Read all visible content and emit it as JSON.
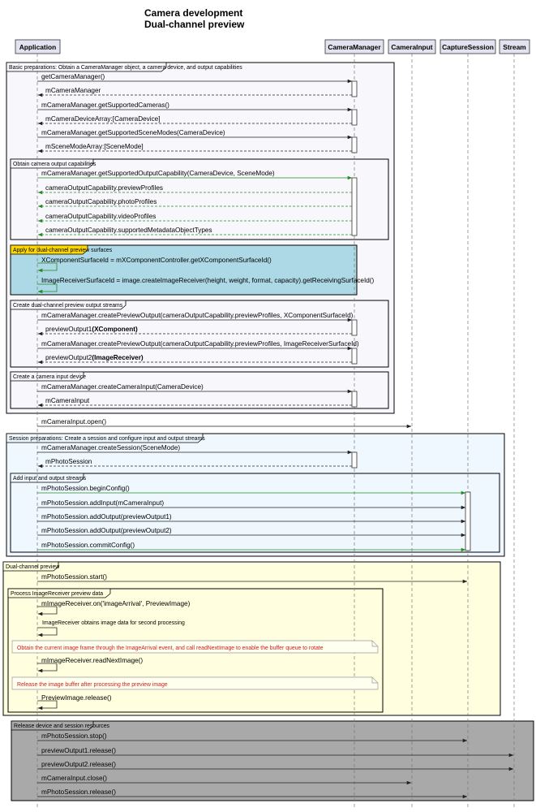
{
  "title": {
    "line1": "Camera development",
    "line2": "Dual-channel preview"
  },
  "participants": [
    "Application",
    "CameraManager",
    "CameraInput",
    "CaptureSession",
    "Stream"
  ],
  "groups": {
    "basic": "Basic preparations: Obtain a CameraManager object, a camera device, and output capabilities",
    "capabilities": "Obtain camera output capabilities",
    "apply_surfaces": "Apply for dual-channel preview surfaces",
    "create_streams": "Create dual-channel preview output streams",
    "create_input": "Create a camera input device",
    "session_prep": "Session preparations: Create a session and configure input and output streams",
    "add_streams": "Add input and output streams",
    "dual_preview": "Dual-channel preview",
    "process_receiver": "Process ImageReceiver preview data",
    "release": "Release device and session resources"
  },
  "messages": {
    "m1": "getCameraManager()",
    "m2": "mCameraManager",
    "m3": "mCameraManager.getSupportedCameras()",
    "m4": "mCameraDeviceArray:[CameraDevice]",
    "m5": "mCameraManager.getSupportedSceneModes(CameraDevice)",
    "m6": "mSceneModeArray:[SceneMode]",
    "m7": "mCameraManager.getSupportedOutputCapability(CameraDevice, SceneMode)",
    "m8": "cameraOutputCapability.previewProfiles",
    "m9": "cameraOutputCapability.photoProfiles",
    "m10": "cameraOutputCapability.videoProfiles",
    "m11": "cameraOutputCapability.supportedMetadataObjectTypes",
    "m12": "XComponentSurfaceId = mXComponentController.getXComponentSurfaceId()",
    "m13": "ImageReceiverSurfaceId = image.createImageReceiver(height, weight, format, capacity).getReceivingSurfaceId()",
    "m14": "mCameraManager.createPreviewOutput(cameraOutputCapability.previewProfiles, XComponentSurfaceId)",
    "m15a": "previewOutput1",
    "m15b": "(XComponent)",
    "m16": "mCameraManager.createPreviewOutput(cameraOutputCapability.previewProfiles, ImageReceiverSurfaceId)",
    "m17a": "previewOutput2",
    "m17b": "(ImageReceiver)",
    "m18": "mCameraManager.createCameraInput(CameraDevice)",
    "m19": "mCameraInput",
    "m20": "mCameraInput.open()",
    "m21": "mCameraManager.createSession(SceneMode)",
    "m22": "mPhotoSession",
    "m23": "mPhotoSession.beginConfig()",
    "m24": "mPhotoSession.addInput(mCameraInput)",
    "m25": "mPhotoSession.addOutput(previewOutput1)",
    "m26": "mPhotoSession.addOutput(previewOutput2)",
    "m27": "mPhotoSession.commitConfig()",
    "m28": "mPhotoSession.start()",
    "m29": "mImageReceiver.on('imageArrival', PreviewImage)",
    "m30": "ImageReceiver obtains image data for second processing",
    "m31": "mImageReceiver.readNextImage()",
    "m32": "PreviewImage.release()",
    "m33": "mPhotoSession.stop()",
    "m34": "previewOutput1.release()",
    "m35": "previewOutput2.release()",
    "m36": "mCameraInput.close()",
    "m37": "mPhotoSession.release()"
  },
  "notes": {
    "n1": "Obtain the current image frame through the ImageArrival event, and call readNextImage to enable the buffer queue to rotate",
    "n2": "Release the image buffer after processing the preview image"
  },
  "colors": {
    "apply_bg": "#add8e6",
    "apply_tab": "#ffd700",
    "session_bg": "#f0f8ff",
    "preview_bg": "#ffffe0",
    "release_bg": "#a9a9a9",
    "basic_bg": "#f8f8fc",
    "green_arrow": "#228b22",
    "participant_bg": "#e2e2f0",
    "note_text": "#d02020"
  }
}
